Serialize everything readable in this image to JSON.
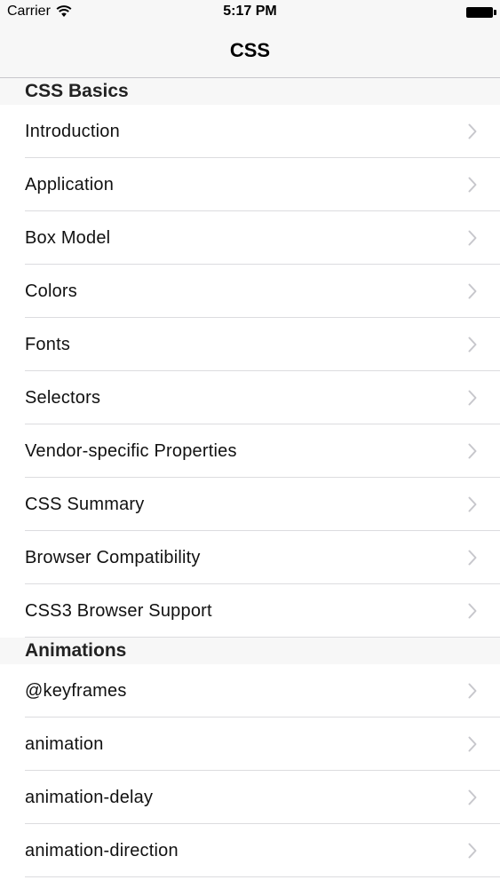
{
  "status_bar": {
    "carrier": "Carrier",
    "time": "5:17 PM",
    "wifi_icon": "wifi-icon",
    "battery_icon": "battery-icon"
  },
  "nav": {
    "title": "CSS"
  },
  "sections": [
    {
      "header": "CSS Basics",
      "items": [
        {
          "label": "Introduction"
        },
        {
          "label": "Application"
        },
        {
          "label": "Box Model"
        },
        {
          "label": "Colors"
        },
        {
          "label": "Fonts"
        },
        {
          "label": "Selectors"
        },
        {
          "label": "Vendor-specific Properties"
        },
        {
          "label": "CSS Summary"
        },
        {
          "label": "Browser Compatibility"
        },
        {
          "label": "CSS3 Browser Support"
        }
      ]
    },
    {
      "header": "Animations",
      "items": [
        {
          "label": "@keyframes"
        },
        {
          "label": "animation"
        },
        {
          "label": "animation-delay"
        },
        {
          "label": "animation-direction"
        }
      ]
    }
  ],
  "colors": {
    "bar_background": "#f7f7f7",
    "separator": "#dcdcdf",
    "chevron": "#c7c7cc"
  },
  "icons": {
    "row_disclosure": "chevron-right-icon"
  }
}
